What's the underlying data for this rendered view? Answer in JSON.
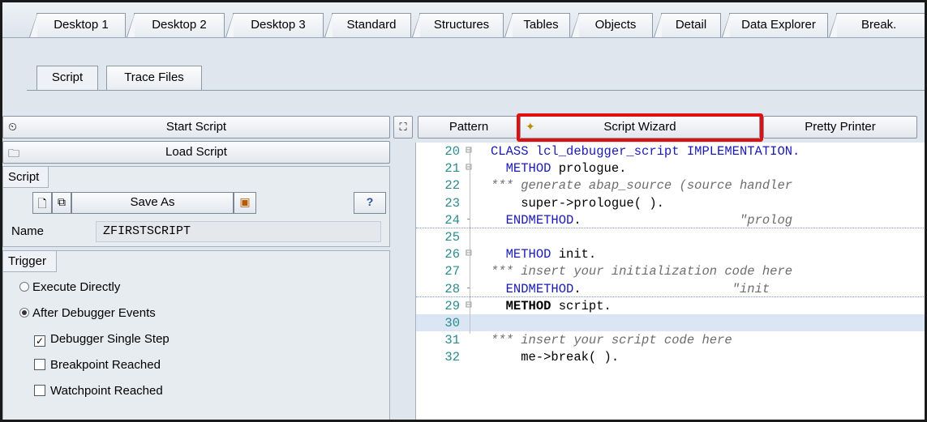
{
  "top_tabs": [
    "Desktop 1",
    "Desktop 2",
    "Desktop 3",
    "Standard",
    "Structures",
    "Tables",
    "Objects",
    "Detail",
    "Data Explorer",
    "Break."
  ],
  "sub_tabs": {
    "script": "Script",
    "trace": "Trace Files"
  },
  "left": {
    "start_script": "Start Script",
    "load_script": "Load Script",
    "script_group": {
      "title": "Script",
      "save_as": "Save As",
      "name_label": "Name",
      "name_value": "ZFIRSTSCRIPT"
    },
    "trigger_group": {
      "title": "Trigger",
      "execute_directly": "Execute Directly",
      "after_debugger_events": "After Debugger Events",
      "debugger_single_step": "Debugger Single Step",
      "breakpoint_reached": "Breakpoint Reached",
      "watchpoint_reached": "Watchpoint Reached"
    }
  },
  "toolbar": {
    "pattern": "Pattern",
    "script_wizard": "Script Wizard",
    "pretty_printer": "Pretty Printer"
  },
  "code": [
    {
      "n": "20",
      "fold": "⊟",
      "parts": [
        [
          "kw",
          "CLASS lcl_debugger_script IMPLEMENTATION."
        ]
      ]
    },
    {
      "n": "21",
      "fold": "⊟",
      "parts": [
        [
          "",
          "  "
        ],
        [
          "kw",
          "METHOD"
        ],
        [
          "",
          " prologue."
        ]
      ]
    },
    {
      "n": "22",
      "fold": "",
      "parts": [
        [
          "cm",
          "*** generate abap_source (source handler"
        ]
      ]
    },
    {
      "n": "23",
      "fold": "",
      "parts": [
        [
          "",
          "    super->prologue( )."
        ]
      ]
    },
    {
      "n": "24",
      "fold": "-",
      "parts": [
        [
          "",
          "  "
        ],
        [
          "kw",
          "ENDMETHOD"
        ],
        [
          "",
          ".                     "
        ],
        [
          "cm",
          "\"prolog"
        ]
      ]
    },
    {
      "n": "25",
      "fold": "",
      "parts": [
        [
          "",
          ""
        ]
      ]
    },
    {
      "n": "26",
      "fold": "⊟",
      "parts": [
        [
          "",
          "  "
        ],
        [
          "kw",
          "METHOD"
        ],
        [
          "",
          " init."
        ]
      ]
    },
    {
      "n": "27",
      "fold": "",
      "parts": [
        [
          "cm",
          "*** insert your initialization code here"
        ]
      ]
    },
    {
      "n": "28",
      "fold": "-",
      "parts": [
        [
          "",
          "  "
        ],
        [
          "kw",
          "ENDMETHOD"
        ],
        [
          "",
          ".                    "
        ],
        [
          "cm",
          "\"init"
        ]
      ]
    },
    {
      "n": "29",
      "fold": "⊟",
      "parts": [
        [
          "",
          "  "
        ],
        [
          "bold",
          "METHOD"
        ],
        [
          "",
          " script."
        ]
      ]
    },
    {
      "n": "30",
      "fold": "",
      "parts": [
        [
          "",
          ""
        ]
      ]
    },
    {
      "n": "31",
      "fold": "",
      "parts": [
        [
          "cm",
          "*** insert your script code here"
        ]
      ]
    },
    {
      "n": "32",
      "fold": "",
      "parts": [
        [
          "",
          "    me->break( )."
        ]
      ]
    }
  ]
}
